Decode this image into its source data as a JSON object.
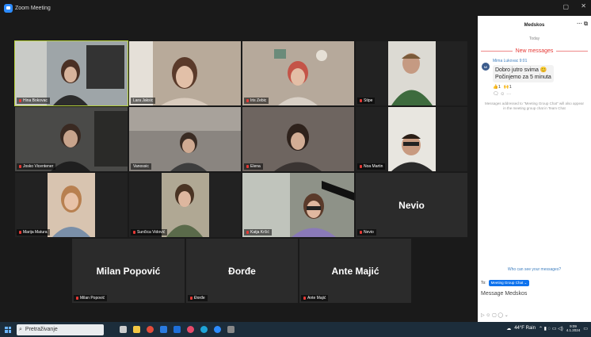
{
  "window": {
    "title": "Zoom Meeting"
  },
  "tiles": [
    {
      "name": "Hina Bokovac",
      "type": "video",
      "active": true
    },
    {
      "name": "Lara Jaksic",
      "type": "video"
    },
    {
      "name": "Iris Zebic",
      "type": "video"
    },
    {
      "name": "Stipe",
      "type": "video"
    },
    {
      "name": "Josko Vicentener",
      "type": "video"
    },
    {
      "name": "Vanossic",
      "type": "video"
    },
    {
      "name": "Elena",
      "type": "video"
    },
    {
      "name": "Noa Martin",
      "type": "video"
    },
    {
      "name": "Marija Matura",
      "type": "video"
    },
    {
      "name": "Sunčica Vidović",
      "type": "video"
    },
    {
      "name": "Katja Krčić",
      "type": "video"
    },
    {
      "name": "Nevio",
      "type": "text",
      "display": "Nevio"
    },
    {
      "name": "Milan Popović",
      "type": "text",
      "display": "Milan Popović"
    },
    {
      "name": "Đorđe",
      "type": "text",
      "display": "Đorđe"
    },
    {
      "name": "Ante Majić",
      "type": "text",
      "display": "Ante Majić"
    }
  ],
  "chat": {
    "title": "Medskos",
    "today": "Today",
    "new_messages": "New messages",
    "message": {
      "sender": "Mima Lukovac 9:01",
      "initials": "MI",
      "line1": "Dobro jutro svima 😊",
      "line2": "Počinjemo za 5 minuta",
      "react1": "👍1",
      "react2": "🙌1",
      "tools": "🗨 ☺ ···"
    },
    "note": "Messages addressed to \"Meeting Group Chat\" will also appear in the meeting group chat in Team Chat",
    "who_can_see": "Who can see your messages?",
    "to_label": "To:",
    "to_chip": "Meeting Group Chat ⌄",
    "input_placeholder": "Message Medskos",
    "controls": "▷ ☺ ▢ ◯ ⌄"
  },
  "taskbar": {
    "search": "Pretraživanje",
    "weather": "44°F Rain",
    "time": "9:09",
    "date": "4.1.2024"
  }
}
